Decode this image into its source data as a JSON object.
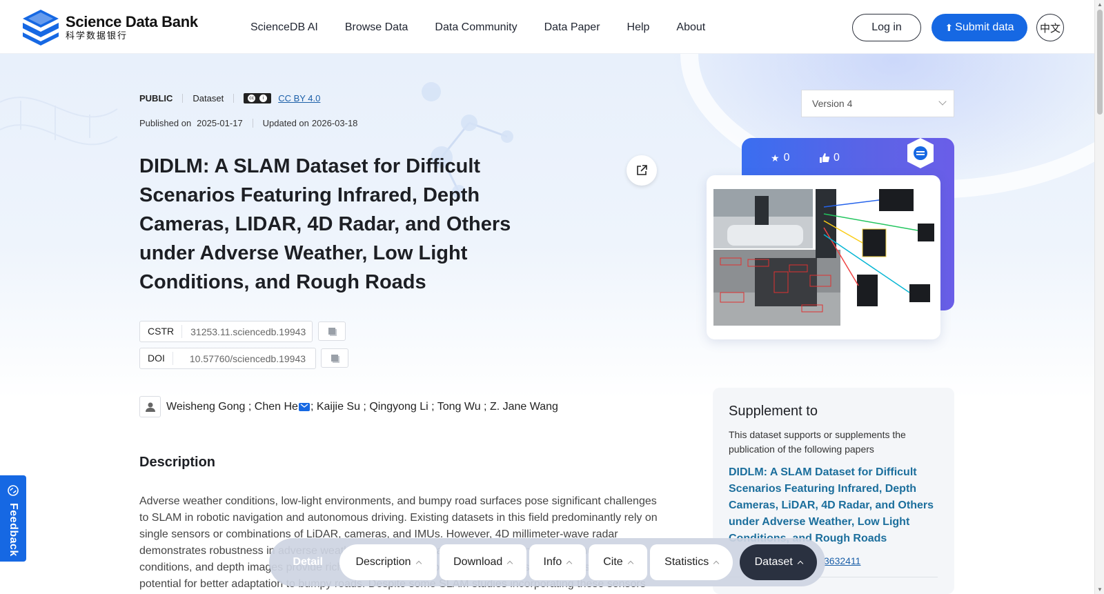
{
  "header": {
    "logo_en": "Science Data Bank",
    "logo_cn": "科学数据银行",
    "nav": [
      "ScienceDB AI",
      "Browse Data",
      "Data Community",
      "Data Paper",
      "Help",
      "About"
    ],
    "login": "Log in",
    "submit": "Submit data",
    "lang": "中文"
  },
  "meta": {
    "visibility": "PUBLIC",
    "type": "Dataset",
    "license": "CC BY 4.0",
    "published_label": "Published on",
    "published": "2025-01-17",
    "updated_label": "Updated on",
    "updated": "2026-03-18"
  },
  "title": "DIDLM: A SLAM Dataset for Difficult Scenarios Featuring Infrared, Depth Cameras, LIDAR, 4D Radar, and Others under Adverse Weather, Low Light Conditions, and Rough Roads",
  "identifiers": {
    "cstr_label": "CSTR",
    "cstr": "31253.11.sciencedb.19943",
    "doi_label": "DOI",
    "doi": "10.57760/sciencedb.19943"
  },
  "authors": {
    "before_mail": "Weisheng Gong ; Chen He",
    "after_mail": "; Kaijie Su ; Qingyong Li ; Tong Wu ; Z. Jane Wang"
  },
  "description": {
    "heading": "Description",
    "text": "Adverse weather conditions, low-light environments, and bumpy road surfaces pose significant challenges to SLAM in robotic navigation and autonomous driving. Existing datasets in this field predominantly rely on single sensors or combinations of LiDAR, cameras, and IMUs. However, 4D millimeter-wave radar demonstrates robustness in adverse weather, infrared cameras excel in capturing details under low-light conditions, and depth images provide richer spatial information. Multi-sensor fusion methods also show potential for better adaptation to bumpy roads. Despite some SLAM studies incorporating these sensors"
  },
  "side": {
    "version": "Version 4",
    "stars": "0",
    "likes": "0"
  },
  "supplement": {
    "title": "Supplement to",
    "subtitle": "This dataset supports or supplements the publication of the following papers",
    "paper": "DIDLM: A SLAM Dataset for Difficult Scenarios Featuring Infrared, Depth Cameras, LiDAR, 4D Radar, and Others under Adverse Weather, Low Light Conditions, and Rough Roads",
    "link": "3632411"
  },
  "feedback": "Feedback",
  "floatbar": {
    "detail": "Detail",
    "items": [
      "Description",
      "Download",
      "Info",
      "Cite",
      "Statistics",
      "Dataset"
    ]
  },
  "colors": {
    "primary": "#1668e3",
    "paper_link": "#1b6e9c",
    "dark_pill": "#2a3140"
  }
}
